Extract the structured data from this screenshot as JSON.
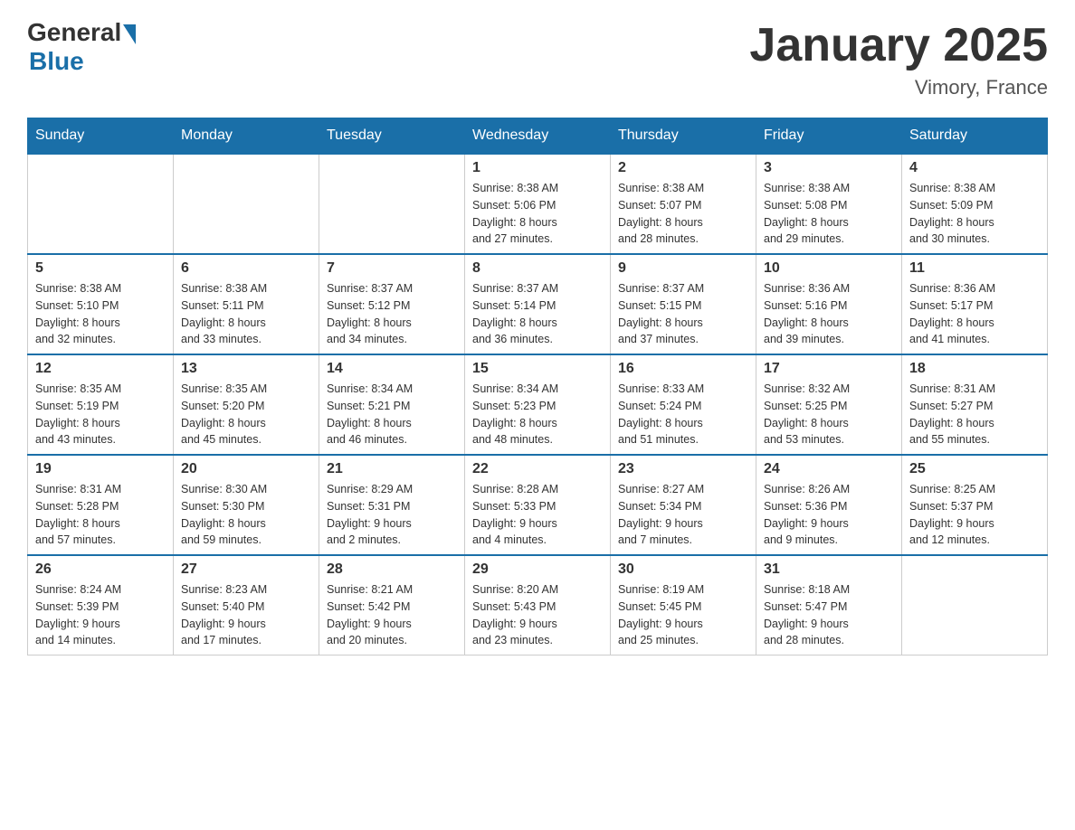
{
  "header": {
    "logo_general": "General",
    "logo_blue": "Blue",
    "title": "January 2025",
    "subtitle": "Vimory, France"
  },
  "weekdays": [
    "Sunday",
    "Monday",
    "Tuesday",
    "Wednesday",
    "Thursday",
    "Friday",
    "Saturday"
  ],
  "weeks": [
    [
      {
        "day": "",
        "info": ""
      },
      {
        "day": "",
        "info": ""
      },
      {
        "day": "",
        "info": ""
      },
      {
        "day": "1",
        "info": "Sunrise: 8:38 AM\nSunset: 5:06 PM\nDaylight: 8 hours\nand 27 minutes."
      },
      {
        "day": "2",
        "info": "Sunrise: 8:38 AM\nSunset: 5:07 PM\nDaylight: 8 hours\nand 28 minutes."
      },
      {
        "day": "3",
        "info": "Sunrise: 8:38 AM\nSunset: 5:08 PM\nDaylight: 8 hours\nand 29 minutes."
      },
      {
        "day": "4",
        "info": "Sunrise: 8:38 AM\nSunset: 5:09 PM\nDaylight: 8 hours\nand 30 minutes."
      }
    ],
    [
      {
        "day": "5",
        "info": "Sunrise: 8:38 AM\nSunset: 5:10 PM\nDaylight: 8 hours\nand 32 minutes."
      },
      {
        "day": "6",
        "info": "Sunrise: 8:38 AM\nSunset: 5:11 PM\nDaylight: 8 hours\nand 33 minutes."
      },
      {
        "day": "7",
        "info": "Sunrise: 8:37 AM\nSunset: 5:12 PM\nDaylight: 8 hours\nand 34 minutes."
      },
      {
        "day": "8",
        "info": "Sunrise: 8:37 AM\nSunset: 5:14 PM\nDaylight: 8 hours\nand 36 minutes."
      },
      {
        "day": "9",
        "info": "Sunrise: 8:37 AM\nSunset: 5:15 PM\nDaylight: 8 hours\nand 37 minutes."
      },
      {
        "day": "10",
        "info": "Sunrise: 8:36 AM\nSunset: 5:16 PM\nDaylight: 8 hours\nand 39 minutes."
      },
      {
        "day": "11",
        "info": "Sunrise: 8:36 AM\nSunset: 5:17 PM\nDaylight: 8 hours\nand 41 minutes."
      }
    ],
    [
      {
        "day": "12",
        "info": "Sunrise: 8:35 AM\nSunset: 5:19 PM\nDaylight: 8 hours\nand 43 minutes."
      },
      {
        "day": "13",
        "info": "Sunrise: 8:35 AM\nSunset: 5:20 PM\nDaylight: 8 hours\nand 45 minutes."
      },
      {
        "day": "14",
        "info": "Sunrise: 8:34 AM\nSunset: 5:21 PM\nDaylight: 8 hours\nand 46 minutes."
      },
      {
        "day": "15",
        "info": "Sunrise: 8:34 AM\nSunset: 5:23 PM\nDaylight: 8 hours\nand 48 minutes."
      },
      {
        "day": "16",
        "info": "Sunrise: 8:33 AM\nSunset: 5:24 PM\nDaylight: 8 hours\nand 51 minutes."
      },
      {
        "day": "17",
        "info": "Sunrise: 8:32 AM\nSunset: 5:25 PM\nDaylight: 8 hours\nand 53 minutes."
      },
      {
        "day": "18",
        "info": "Sunrise: 8:31 AM\nSunset: 5:27 PM\nDaylight: 8 hours\nand 55 minutes."
      }
    ],
    [
      {
        "day": "19",
        "info": "Sunrise: 8:31 AM\nSunset: 5:28 PM\nDaylight: 8 hours\nand 57 minutes."
      },
      {
        "day": "20",
        "info": "Sunrise: 8:30 AM\nSunset: 5:30 PM\nDaylight: 8 hours\nand 59 minutes."
      },
      {
        "day": "21",
        "info": "Sunrise: 8:29 AM\nSunset: 5:31 PM\nDaylight: 9 hours\nand 2 minutes."
      },
      {
        "day": "22",
        "info": "Sunrise: 8:28 AM\nSunset: 5:33 PM\nDaylight: 9 hours\nand 4 minutes."
      },
      {
        "day": "23",
        "info": "Sunrise: 8:27 AM\nSunset: 5:34 PM\nDaylight: 9 hours\nand 7 minutes."
      },
      {
        "day": "24",
        "info": "Sunrise: 8:26 AM\nSunset: 5:36 PM\nDaylight: 9 hours\nand 9 minutes."
      },
      {
        "day": "25",
        "info": "Sunrise: 8:25 AM\nSunset: 5:37 PM\nDaylight: 9 hours\nand 12 minutes."
      }
    ],
    [
      {
        "day": "26",
        "info": "Sunrise: 8:24 AM\nSunset: 5:39 PM\nDaylight: 9 hours\nand 14 minutes."
      },
      {
        "day": "27",
        "info": "Sunrise: 8:23 AM\nSunset: 5:40 PM\nDaylight: 9 hours\nand 17 minutes."
      },
      {
        "day": "28",
        "info": "Sunrise: 8:21 AM\nSunset: 5:42 PM\nDaylight: 9 hours\nand 20 minutes."
      },
      {
        "day": "29",
        "info": "Sunrise: 8:20 AM\nSunset: 5:43 PM\nDaylight: 9 hours\nand 23 minutes."
      },
      {
        "day": "30",
        "info": "Sunrise: 8:19 AM\nSunset: 5:45 PM\nDaylight: 9 hours\nand 25 minutes."
      },
      {
        "day": "31",
        "info": "Sunrise: 8:18 AM\nSunset: 5:47 PM\nDaylight: 9 hours\nand 28 minutes."
      },
      {
        "day": "",
        "info": ""
      }
    ]
  ]
}
